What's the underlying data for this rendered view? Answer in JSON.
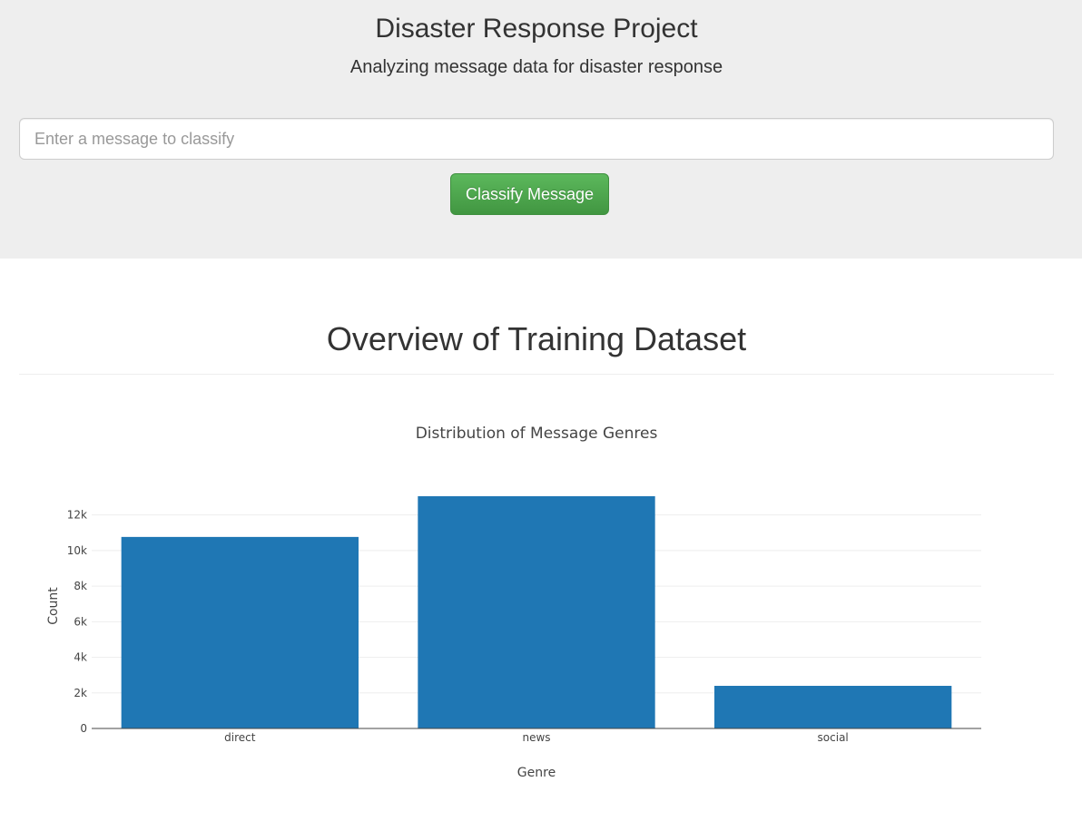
{
  "header": {
    "title": "Disaster Response Project",
    "subtitle": "Analyzing message data for disaster response"
  },
  "classifier": {
    "input_placeholder": "Enter a message to classify",
    "input_value": "",
    "button_label": "Classify Message"
  },
  "overview": {
    "title": "Overview of Training Dataset"
  },
  "colors": {
    "bar": "#1f77b4",
    "button": "#5cb85c",
    "jumbotron_bg": "#eeeeee"
  },
  "chart_data": {
    "type": "bar",
    "title": "Distribution of Message Genres",
    "xlabel": "Genre",
    "ylabel": "Count",
    "categories": [
      "direct",
      "news",
      "social"
    ],
    "values": [
      10766,
      13054,
      2396
    ],
    "ylim": [
      0,
      13054
    ],
    "yticks": [
      0,
      2000,
      4000,
      6000,
      8000,
      10000,
      12000
    ],
    "ytick_labels": [
      "0",
      "2k",
      "4k",
      "6k",
      "8k",
      "10k",
      "12k"
    ],
    "grid": true,
    "legend": "none"
  }
}
